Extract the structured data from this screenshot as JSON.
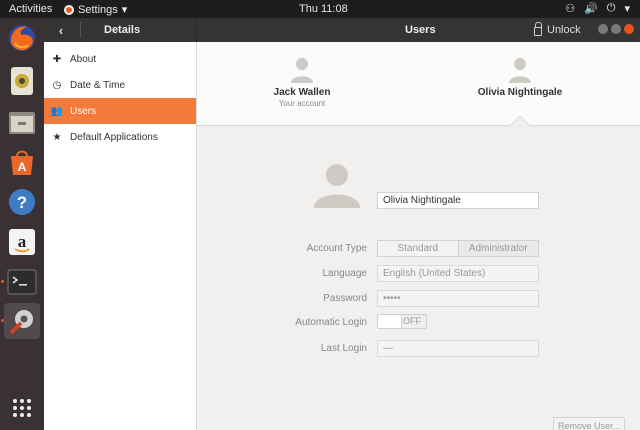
{
  "topbar": {
    "activities": "Activities",
    "app_menu": "Settings",
    "app_menu_arrow": "▾",
    "clock": "Thu 11:08",
    "network_icon": "⚇",
    "volume_icon": "🔊",
    "power_icon": "⏻",
    "tray_arrow": "▾"
  },
  "dock": {
    "items": [
      "firefox-icon",
      "rhythmbox-icon",
      "files-icon",
      "software-center-icon",
      "help-icon",
      "amazon-icon",
      "terminal-icon",
      "settings-icon"
    ],
    "show_apps": "show-applications-icon"
  },
  "headerbar": {
    "back": "‹",
    "left_title": "Details",
    "center_title": "Users",
    "unlock": "Unlock"
  },
  "sidebar": {
    "items": [
      {
        "icon": "✚",
        "label": "About"
      },
      {
        "icon": "◷",
        "label": "Date & Time"
      },
      {
        "icon": "👥",
        "label": "Users"
      },
      {
        "icon": "★",
        "label": "Default Applications"
      }
    ]
  },
  "users": [
    {
      "name": "Jack Wallen",
      "subtitle": "Your account"
    },
    {
      "name": "Olivia Nightingale",
      "subtitle": ""
    }
  ],
  "detail": {
    "full_name": "Olivia Nightingale",
    "account_type_label": "Account Type",
    "account_type_options": [
      "Standard",
      "Administrator"
    ],
    "language_label": "Language",
    "language_value": "English (United States)",
    "password_label": "Password",
    "password_value": "•••••",
    "auto_login_label": "Automatic Login",
    "auto_login_value": "OFF",
    "last_login_label": "Last Login",
    "last_login_value": "—",
    "remove_button": "Remove User..."
  },
  "colors": {
    "accent": "#E95420",
    "selection": "#F27A3A",
    "topbar": "#1D1D1D",
    "dock": "#3A3135"
  }
}
